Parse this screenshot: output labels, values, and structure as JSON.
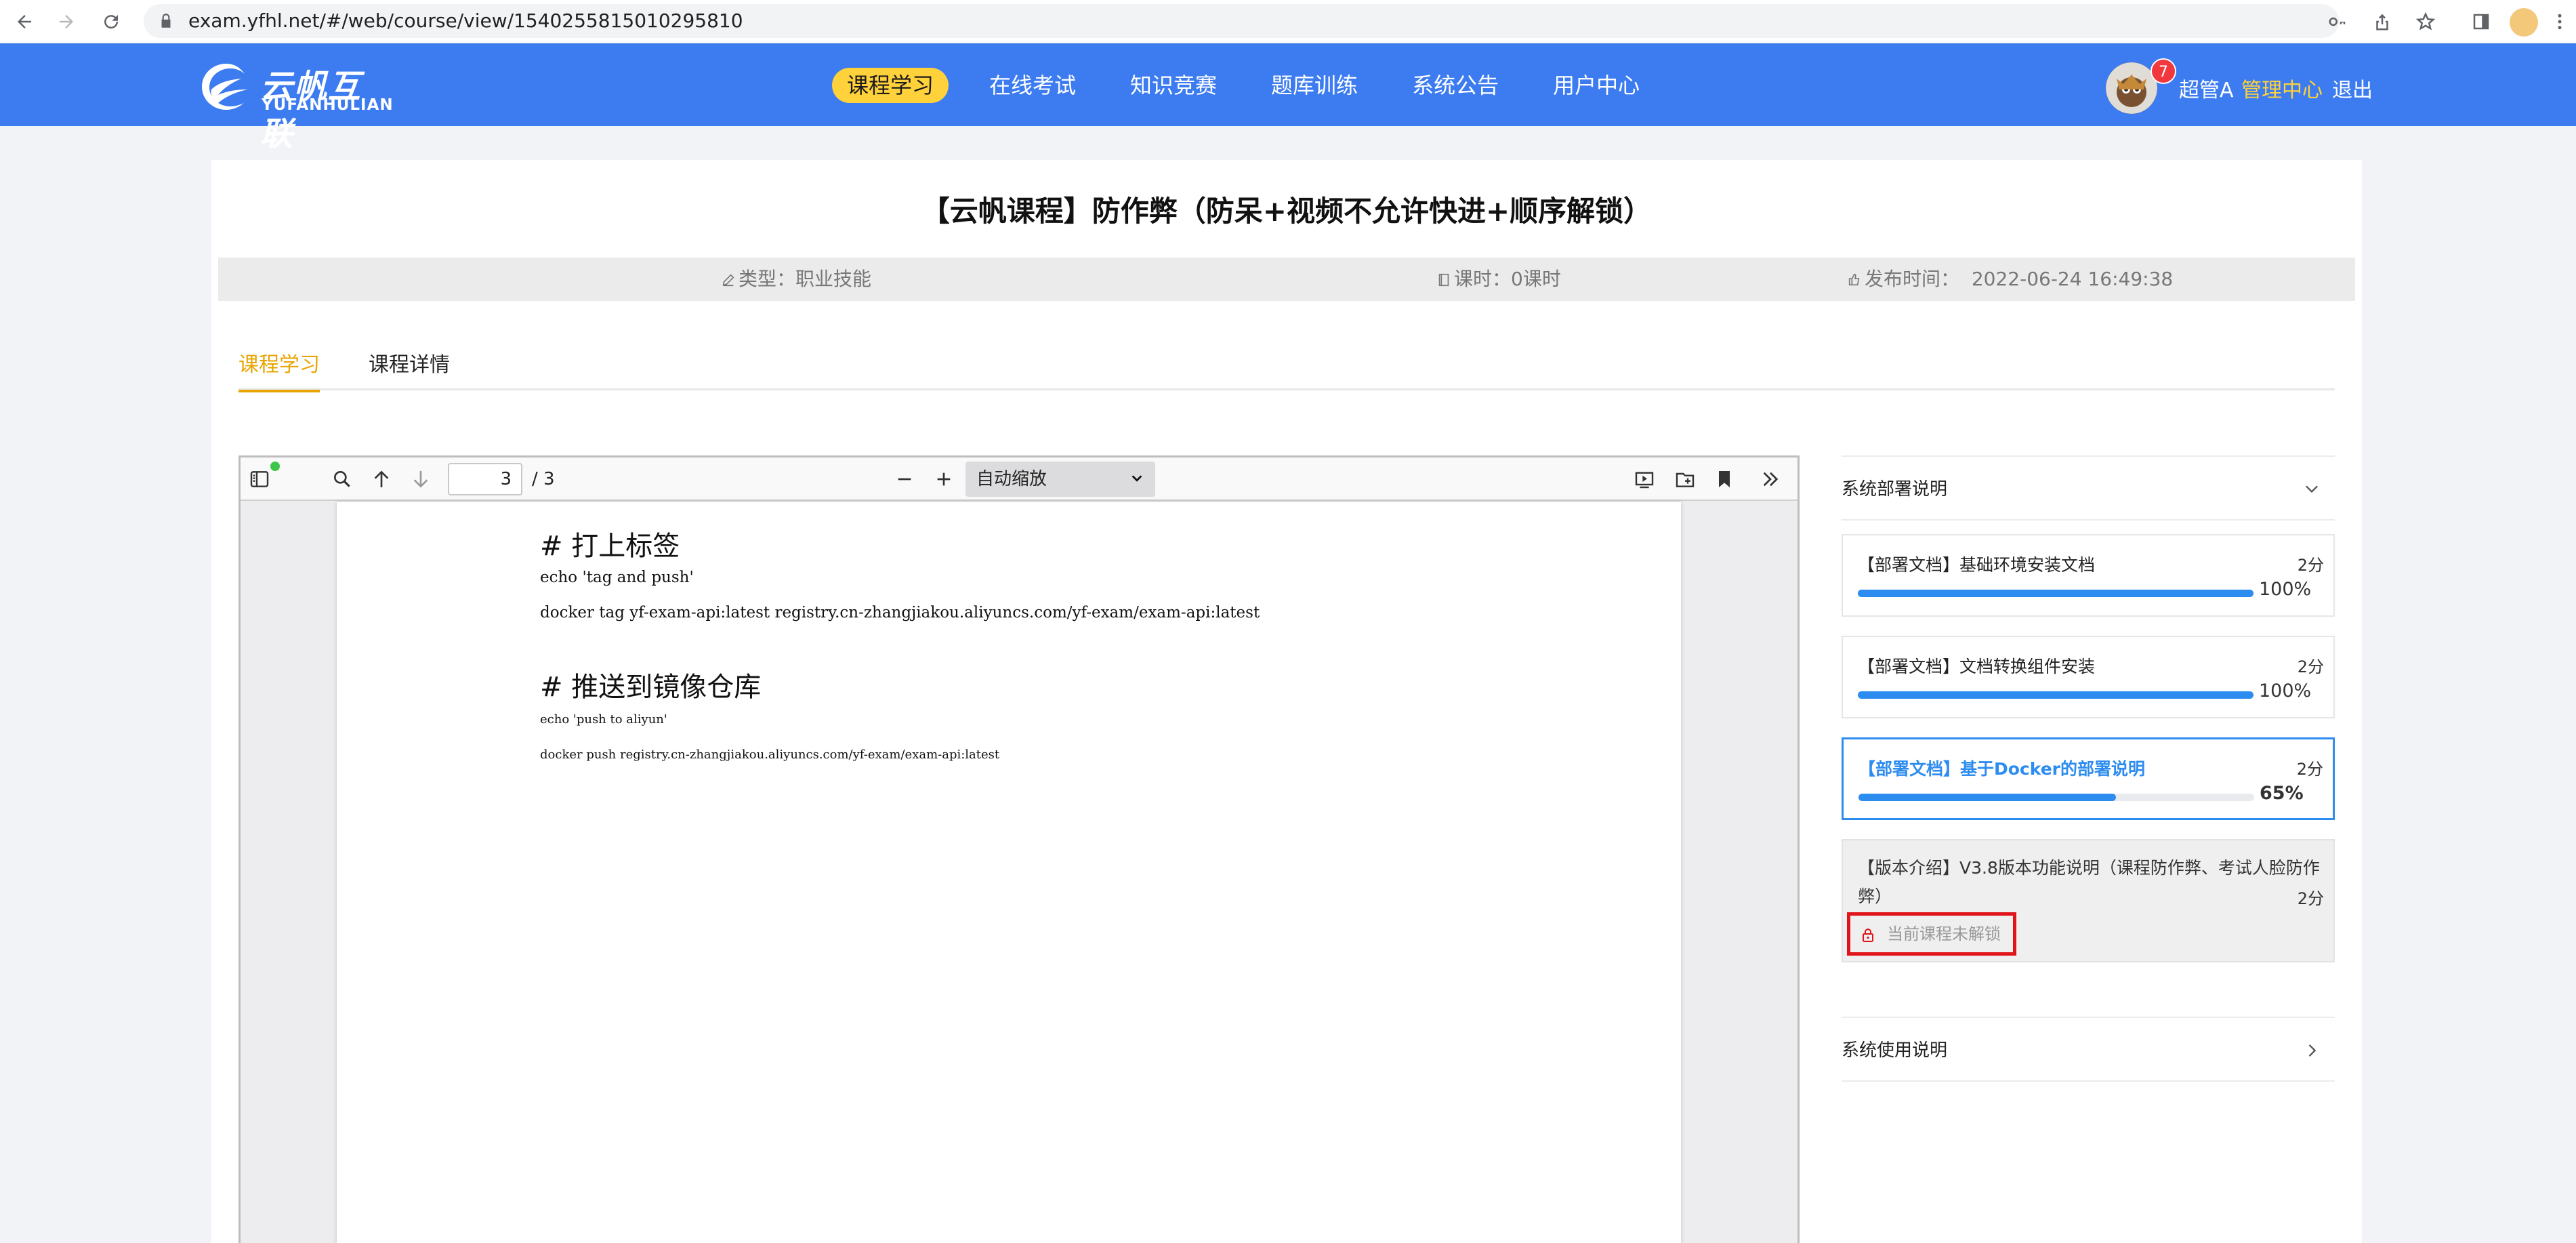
{
  "browser": {
    "url": "exam.yfhl.net/#/web/course/view/1540255815010295810"
  },
  "header": {
    "logo_cn": "云帆互联",
    "logo_en": "YUFANHULIAN",
    "nav": [
      "课程学习",
      "在线考试",
      "知识竞赛",
      "题库训练",
      "系统公告",
      "用户中心"
    ],
    "active_nav": "课程学习",
    "badge_count": "7",
    "username": "超管A",
    "admin_link": "管理中心",
    "logout": "退出",
    "accent": "#ffd13a",
    "brand": "#3c7cf0"
  },
  "course": {
    "title": "【云帆课程】防作弊（防呆+视频不允许快进+顺序解锁）",
    "type_label": "类型：",
    "type_value": "职业技能",
    "hours_label": "课时：",
    "hours_value": "0课时",
    "publish_label": "发布时间：",
    "publish_value": "2022-06-24 16:49:38"
  },
  "tabs": [
    "课程学习",
    "课程详情"
  ],
  "viewer": {
    "page_current": "3",
    "page_total": "/ 3",
    "zoom": "自动缩放",
    "heading1": "# 打上标签",
    "line1": "echo 'tag and push'",
    "line2": "docker tag yf-exam-api:latest registry.cn-zhangjiakou.aliyuncs.com/yf-exam/exam-api:latest",
    "heading2": "# 推送到镜像仓库",
    "line3": "echo 'push to aliyun'",
    "line4": "docker push registry.cn-zhangjiakou.aliyuncs.com/yf-exam/exam-api:latest"
  },
  "sidebar": {
    "section1": "系统部署说明",
    "lessons": [
      {
        "name": "【部署文档】基础环境安装文档",
        "points": "2分",
        "progress": 100,
        "pct": "100%"
      },
      {
        "name": "【部署文档】文档转换组件安装",
        "points": "2分",
        "progress": 100,
        "pct": "100%"
      },
      {
        "name": "【部署文档】基于Docker的部署说明",
        "points": "2分",
        "progress": 65,
        "pct": "65%"
      },
      {
        "name": "【版本介绍】V3.8版本功能说明（课程防作弊、考试人脸防作弊）",
        "points": "2分",
        "locked_text": "当前课程未解锁"
      }
    ],
    "section2": "系统使用说明",
    "progress_color": "#2d8cf0"
  }
}
